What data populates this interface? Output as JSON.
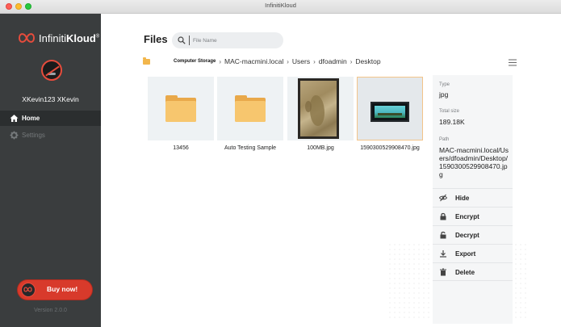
{
  "window": {
    "title": "InfinitiKloud"
  },
  "brand": {
    "name_prefix": "Infiniti",
    "name_bold": "Kloud",
    "reg_mark": "®"
  },
  "user": {
    "name": "XKevin123 XKevin"
  },
  "sidebar": {
    "items": [
      {
        "label": "Home",
        "icon": "home-icon",
        "active": true
      },
      {
        "label": "Settings",
        "icon": "gear-icon",
        "active": false
      }
    ],
    "buy_label": "Buy now!",
    "version": "Version 2.0.0"
  },
  "main": {
    "title": "Files",
    "search": {
      "placeholder": "File Name",
      "value": ""
    },
    "breadcrumb": {
      "root": "Computer Storage",
      "items": [
        "MAC-macmini.local",
        "Users",
        "dfoadmin",
        "Desktop"
      ]
    },
    "files": [
      {
        "name": "13456",
        "kind": "folder",
        "selected": false
      },
      {
        "name": "Auto Testing Sample",
        "kind": "folder",
        "selected": false
      },
      {
        "name": "100MB.jpg",
        "kind": "image-map",
        "selected": false
      },
      {
        "name": "1590300529908470.jpg",
        "kind": "image-screenshot",
        "selected": true
      }
    ]
  },
  "details": {
    "type_label": "Type",
    "type_value": "jpg",
    "size_label": "Total size",
    "size_value": "189.18K",
    "path_label": "Path",
    "path_value": "MAC-macmini.local/Users/dfoadmin/Desktop/1590300529908470.jpg",
    "actions": [
      {
        "label": "Hide",
        "icon": "eye-slash-icon"
      },
      {
        "label": "Encrypt",
        "icon": "lock-icon"
      },
      {
        "label": "Decrypt",
        "icon": "unlock-icon"
      },
      {
        "label": "Export",
        "icon": "export-icon"
      },
      {
        "label": "Delete",
        "icon": "trash-icon"
      }
    ]
  },
  "colors": {
    "accent": "#d83a2b",
    "sidebar": "#3a3d3e",
    "folder": "#f7c66e",
    "selection_border": "#f3c489"
  }
}
